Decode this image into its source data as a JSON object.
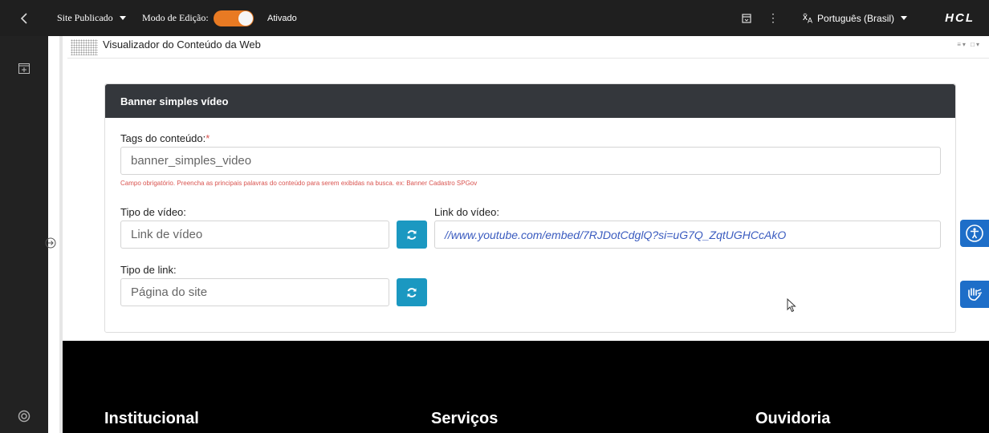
{
  "topbar": {
    "site_status": "Site Publicado",
    "edit_mode_label": "Modo de Edição:",
    "edit_mode_state": "Ativado",
    "language": "Português (Brasil)",
    "brand": "HCL",
    "toggle_color": "#e87a23"
  },
  "portlet": {
    "title": "Visualizador do Conteúdo da Web",
    "tools": "≡▾ □▾"
  },
  "card": {
    "title": "Banner simples vídeo",
    "tags_label": "Tags do conteúdo:",
    "tags_required": "*",
    "tags_value": "banner_simples_video",
    "tags_hint": "Campo obrigatório. Preencha as principais palavras do conteúdo para serem exibidas na busca. ex: Banner Cadastro SPGov",
    "video_type_label": "Tipo de vídeo:",
    "video_type_value": "Link de vídeo",
    "video_link_label": "Link do vídeo:",
    "video_link_value": "//www.youtube.com/embed/7RJDotCdglQ?si=uG7Q_ZqtUGHCcAkO",
    "link_type_label": "Tipo de link:",
    "link_type_value": "Página do site"
  },
  "footer": {
    "col1": "Institucional",
    "col2": "Serviços",
    "col3": "Ouvidoria"
  },
  "icons": {
    "back": "chevron-left-icon",
    "panel": "add-panel-icon",
    "lifebuoy": "lifebuoy-icon",
    "accessibility": "accessibility-icon",
    "sign_language": "sign-language-icon",
    "refresh": "refresh-icon"
  },
  "colors": {
    "accent_button": "#1b98c1",
    "accessibility_blue": "#1e6ec8",
    "card_header": "#34373c",
    "hint_red": "#d9534f"
  }
}
